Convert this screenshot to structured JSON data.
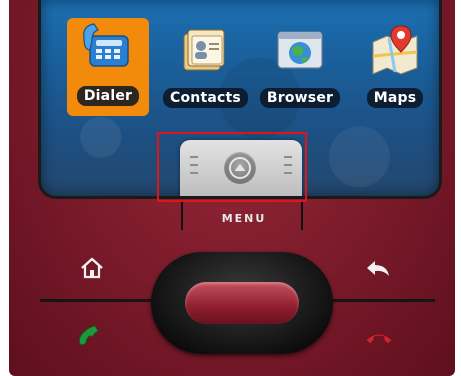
{
  "apps": [
    {
      "label": "Dialer",
      "icon": "dialer-icon",
      "selected": true
    },
    {
      "label": "Contacts",
      "icon": "contacts-icon",
      "selected": false
    },
    {
      "label": "Browser",
      "icon": "browser-icon",
      "selected": false
    },
    {
      "label": "Maps",
      "icon": "maps-icon",
      "selected": false
    }
  ],
  "drawer": {
    "icon": "drawer-up-arrow-icon"
  },
  "hardware": {
    "menu_label": "MENU",
    "home_icon": "home-icon",
    "back_icon": "back-icon",
    "call_icon": "call-icon",
    "end_call_icon": "end-call-icon"
  },
  "colors": {
    "device_body": "#7a1a2a",
    "selection": "#f28a0c",
    "highlight_box": "#e01515",
    "call_green": "#1b9a3a",
    "end_red": "#c9262f"
  }
}
